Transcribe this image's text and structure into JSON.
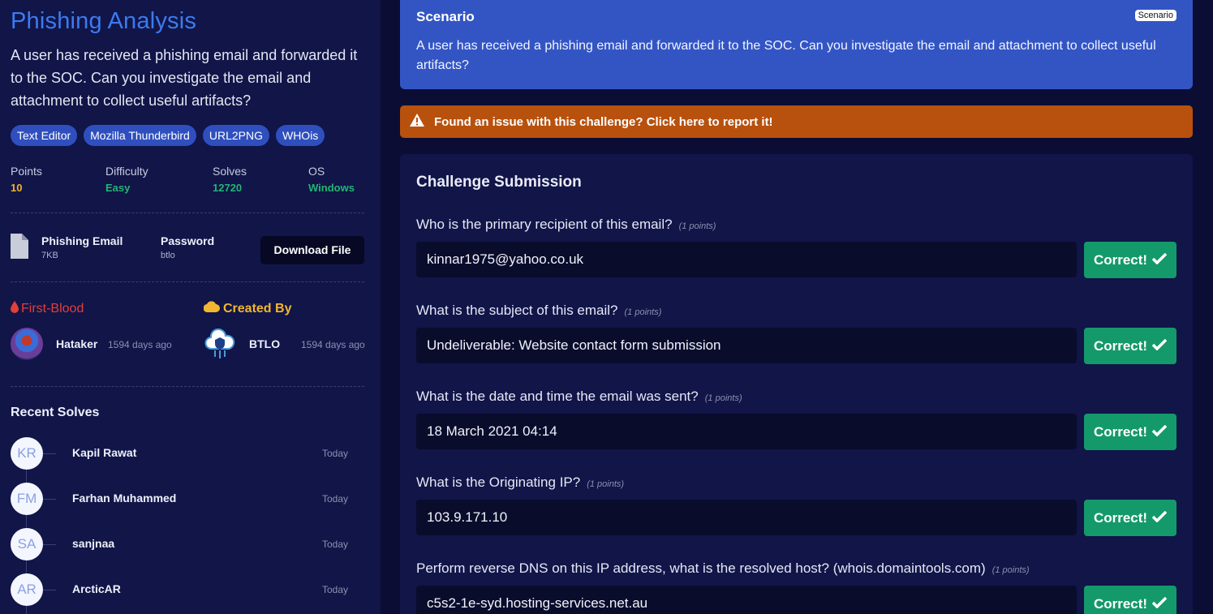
{
  "challenge": {
    "title": "Phishing Analysis",
    "description": "A user has received a phishing email and forwarded it to the SOC. Can you investigate the email and attachment to collect useful artifacts?",
    "tags": [
      "Text Editor",
      "Mozilla Thunderbird",
      "URL2PNG",
      "WHOis"
    ],
    "stats": [
      {
        "label": "Points",
        "value": "10",
        "color": "#f0b429"
      },
      {
        "label": "Difficulty",
        "value": "Easy",
        "color": "#22b573"
      },
      {
        "label": "Solves",
        "value": "12720",
        "color": "#22b573"
      },
      {
        "label": "OS",
        "value": "Windows",
        "color": "#22b573"
      }
    ]
  },
  "file": {
    "icon": "file-icon",
    "name": "Phishing Email",
    "size": "7KB",
    "password_label": "Password",
    "password_value": "btlo",
    "download_label": "Download File"
  },
  "first_blood": {
    "heading": "First-Blood",
    "icon": "blood-drop-icon",
    "user": "Hataker",
    "time": "1594 days ago"
  },
  "created_by": {
    "heading": "Created By",
    "icon": "cloud-icon",
    "user": "BTLO",
    "time": "1594 days ago"
  },
  "recent_solves": {
    "heading": "Recent Solves",
    "items": [
      {
        "initials": "KR",
        "name": "Kapil Rawat",
        "time": "Today"
      },
      {
        "initials": "FM",
        "name": "Farhan Muhammed",
        "time": "Today"
      },
      {
        "initials": "SA",
        "name": "sanjnaa",
        "time": "Today"
      },
      {
        "initials": "AR",
        "name": "ArcticAR",
        "time": "Today"
      }
    ]
  },
  "scenario": {
    "title": "Scenario",
    "badge": "Scenario",
    "text": "A user has received a phishing email and forwarded it to the SOC. Can you investigate the email and attachment to collect useful artifacts?"
  },
  "issue_banner": {
    "icon": "warning-icon",
    "text": "Found an issue with this challenge? Click here to report it!"
  },
  "submission": {
    "title": "Challenge Submission",
    "correct_label": "Correct!",
    "questions": [
      {
        "question": "Who is the primary recipient of this email?",
        "points": "(1 points)",
        "answer": "kinnar1975@yahoo.co.uk"
      },
      {
        "question": "What is the subject of this email?",
        "points": "(1 points)",
        "answer": "Undeliverable: Website contact form submission"
      },
      {
        "question": "What is the date and time the email was sent?",
        "points": "(1 points)",
        "answer": "18 March 2021 04:14"
      },
      {
        "question": "What is the Originating IP?",
        "points": "(1 points)",
        "answer": "103.9.171.10"
      },
      {
        "question": "Perform reverse DNS on this IP address, what is the resolved host? (whois.domaintools.com)",
        "points": "(1 points)",
        "answer": "c5s2-1e-syd.hosting-services.net.au"
      }
    ]
  },
  "colors": {
    "accent_blue": "#3b7bf0",
    "correct_green": "#14996b",
    "warning_orange": "#b8510d",
    "scenario_blue": "#3355c4"
  }
}
